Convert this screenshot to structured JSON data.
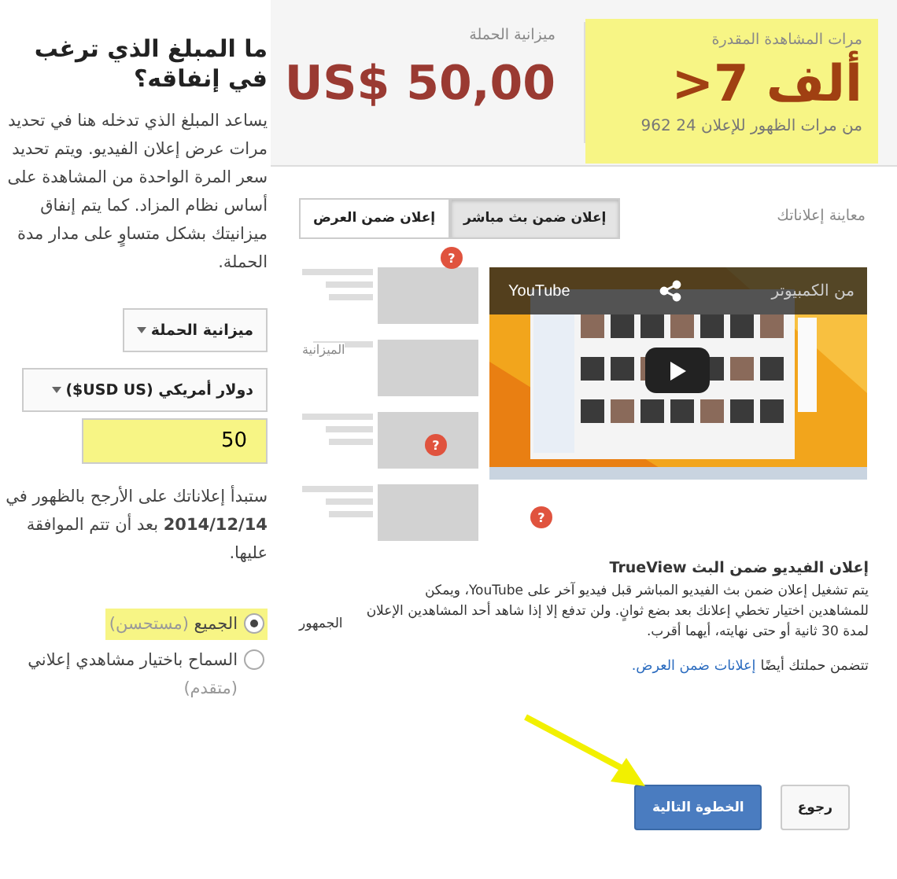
{
  "settings": {
    "heading": "ما المبلغ الذي ترغب في إنفاقه؟",
    "description": "يساعد المبلغ الذي تدخله هنا في تحديد مرات عرض إعلان الفيديو. ويتم تحديد سعر المرة الواحدة من المشاهدة على أساس نظام المزاد. كما يتم إنفاق ميزانيتك بشكل متساوٍ على مدار مدة الحملة.",
    "budget_type": "ميزانية الحملة",
    "currency": "دولار أمريكي (USD US$)",
    "amount": "50",
    "start_note": "ستبدأ إعلاناتك على الأرجح بالظهور في **2014/12/14** بعد أن تتم الموافقة عليها.",
    "audience_options": [
      {
        "label": "الجميع",
        "hint": "(مستحسن)",
        "selected": true
      },
      {
        "label": "السماح باختيار مشاهدي إعلاني",
        "hint": "(متقدم)",
        "selected": false
      }
    ]
  },
  "summary": {
    "views_label": "مرات المشاهدة المقدرة",
    "views": ">7 ألف",
    "impressions": "من مرات الظهور للإعلان 24 962",
    "budget_label": "ميزانية الحملة",
    "budget": "US$ 50,00"
  },
  "preview": {
    "label": "معاينة إعلاناتك",
    "tabs": [
      {
        "label": "إعلان ضمن بث مباشر",
        "selected": true
      },
      {
        "label": "إعلان ضمن العرض",
        "selected": false
      }
    ],
    "overlay_text": "الميزانية",
    "help_badges": [
      "?",
      "?",
      "?"
    ],
    "video": {
      "channel": "YouTube",
      "title": "من الكمبيوتر",
      "kind": "picture"
    }
  },
  "description": {
    "title": "إعلان الفيديو ضمن البث TrueView",
    "text": "يتم تشغيل إعلان ضمن بث الفيديو المباشر قبل فيديو آخر على YouTube، ويمكن للمشاهدين اختيار تخطي إعلانك بعد بضع ثوانٍ. ولن تدفع إلا إذا شاهد أحد المشاهدين الإعلان لمدة 30 ثانية أو حتى نهايته، أيهما أقرب.",
    "overflow_text": "الجمهور",
    "footer_text": "تتضمن حملتك أيضًا",
    "footer_link": "إعلانات ضمن العرض."
  },
  "buttons": [
    {
      "label": "رجوع",
      "kind": "secondary"
    },
    {
      "label": "الخطوة التالية",
      "kind": "primary"
    }
  ]
}
